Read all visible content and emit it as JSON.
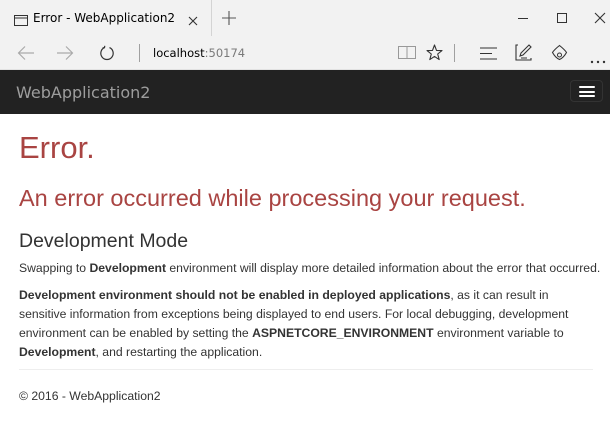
{
  "browser": {
    "tab_title": "Error - WebApplication2",
    "address_host": "localhost",
    "address_port": ":50174"
  },
  "app": {
    "brand": "WebApplication2"
  },
  "page": {
    "error_title": "Error.",
    "error_subtitle": "An error occurred while processing your request.",
    "dev_mode_heading": "Development Mode",
    "p1": {
      "t1": "Swapping to ",
      "b1": "Development",
      "t2": " environment will display more detailed information about the error that occurred."
    },
    "p2": {
      "b1": "Development environment should not be enabled in deployed applications",
      "t1": ", as it can result in sensitive information from exceptions being displayed to end users. For local debugging, development environment can be enabled by setting the ",
      "b2": "ASPNETCORE_ENVIRONMENT",
      "t2": " environment variable to ",
      "b3": "Development",
      "t3": ", and restarting the application."
    },
    "footer": "© 2016 - WebApplication2"
  }
}
